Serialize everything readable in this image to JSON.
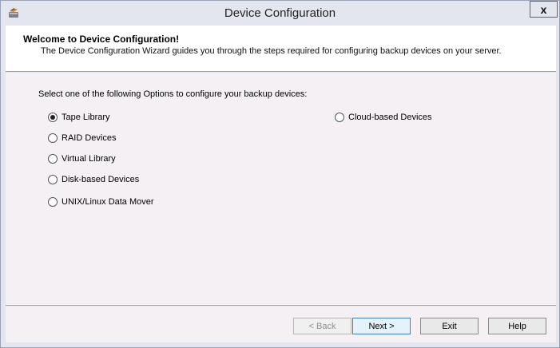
{
  "window": {
    "title": "Device Configuration",
    "close_label": "x"
  },
  "header": {
    "title": "Welcome to Device Configuration!",
    "description": "The Device Configuration Wizard guides you through the steps required for configuring backup devices on your server."
  },
  "content": {
    "prompt": "Select one of the following Options to configure your backup devices:",
    "options": [
      {
        "label": "Tape Library",
        "selected": true
      },
      {
        "label": "RAID Devices",
        "selected": false
      },
      {
        "label": "Virtual Library",
        "selected": false
      },
      {
        "label": "Disk-based Devices",
        "selected": false
      },
      {
        "label": "UNIX/Linux Data Mover",
        "selected": false
      },
      {
        "label": "Cloud-based Devices",
        "selected": false
      }
    ]
  },
  "buttons": {
    "back": "< Back",
    "next": "Next >",
    "exit": "Exit",
    "help": "Help"
  }
}
